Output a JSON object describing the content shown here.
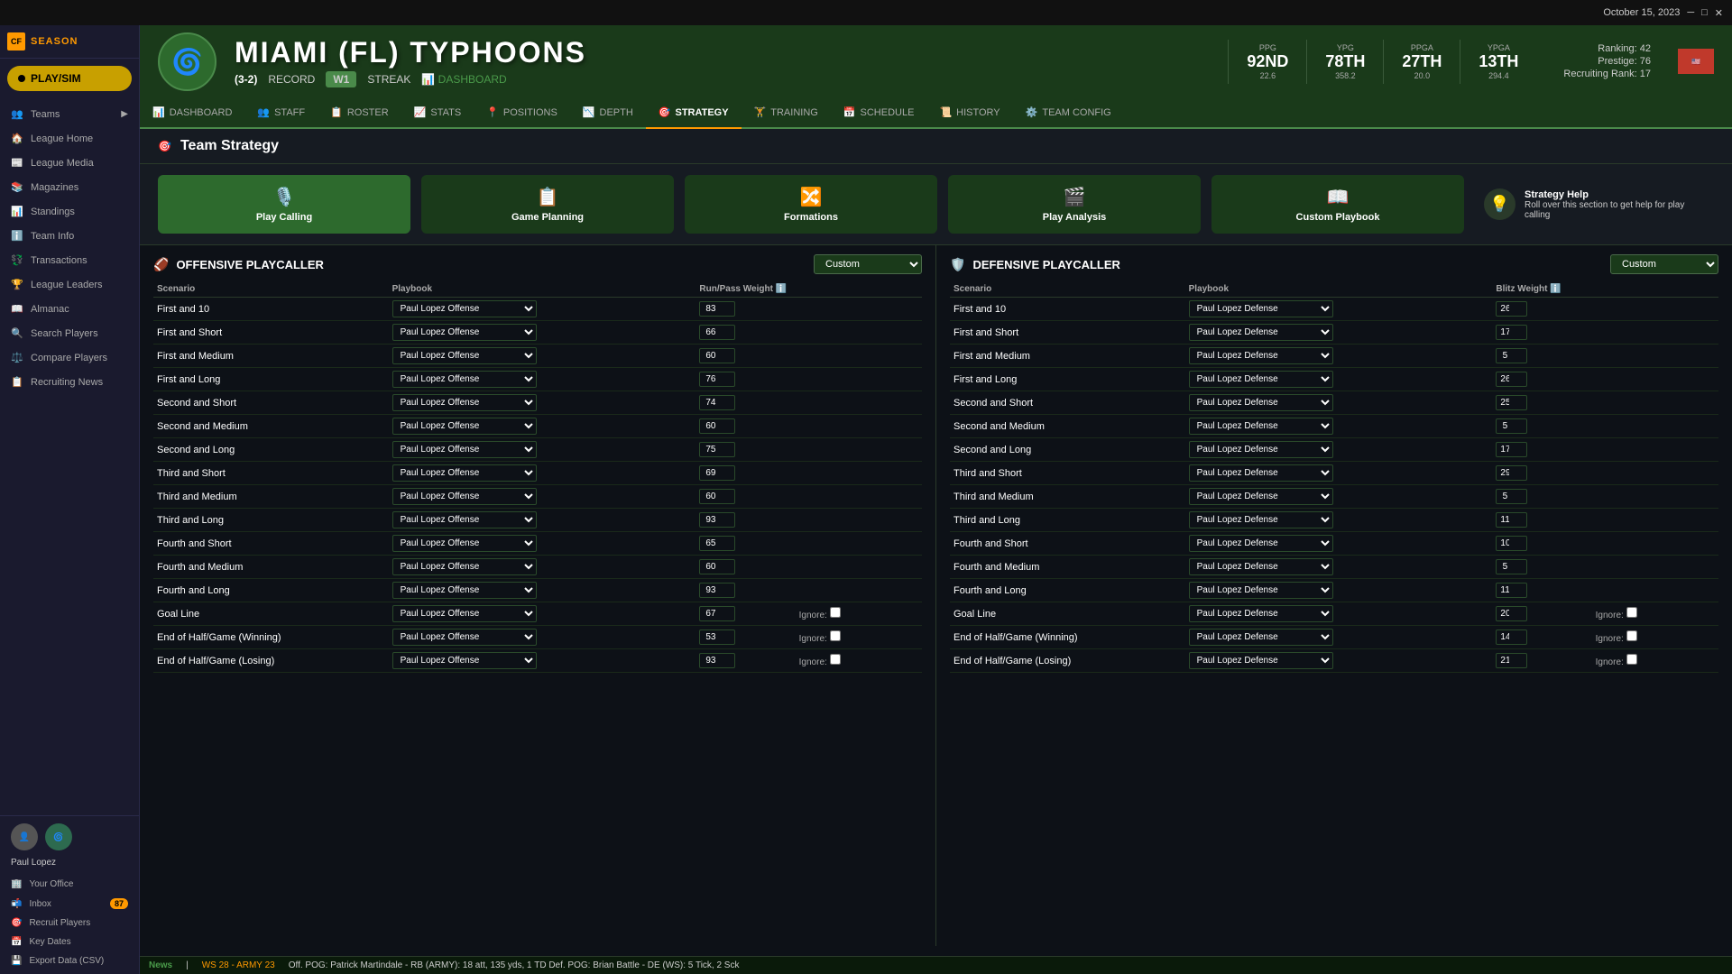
{
  "titlebar": {
    "date": "October 15, 2023"
  },
  "sidebar": {
    "logo_text": "SEASON",
    "play_sim": "PLAY/SIM",
    "items": [
      {
        "label": "Teams",
        "icon": "👥"
      },
      {
        "label": "League Home",
        "icon": "🏠"
      },
      {
        "label": "League Media",
        "icon": "📰"
      },
      {
        "label": "Magazines",
        "icon": "📚"
      },
      {
        "label": "Standings",
        "icon": "📊"
      },
      {
        "label": "Team Info",
        "icon": "ℹ️"
      },
      {
        "label": "Transactions",
        "icon": "💱"
      },
      {
        "label": "League Leaders",
        "icon": "🏆"
      },
      {
        "label": "Almanac",
        "icon": "📖"
      },
      {
        "label": "Search Players",
        "icon": "🔍"
      },
      {
        "label": "Compare Players",
        "icon": "⚖️"
      },
      {
        "label": "Recruiting News",
        "icon": "📋"
      }
    ],
    "user_name": "Paul Lopez",
    "bottom": [
      {
        "label": "Your Office",
        "icon": "🏢"
      },
      {
        "label": "Inbox",
        "icon": "📬",
        "badge": "87"
      },
      {
        "label": "Recruit Players",
        "icon": "🎯"
      },
      {
        "label": "Key Dates",
        "icon": "📅"
      },
      {
        "label": "Export Data (CSV)",
        "icon": "💾"
      }
    ]
  },
  "team": {
    "name": "MIAMI (FL) TYPHOONS",
    "record": "(3-2)",
    "record_label": "RECORD",
    "streak": "W1",
    "streak_label": "STREAK",
    "stats": [
      {
        "label": "PPG",
        "rank": "92ND",
        "value": "22.6"
      },
      {
        "label": "YPG",
        "rank": "78TH",
        "value": "358.2"
      },
      {
        "label": "PPGA",
        "rank": "27TH",
        "value": "20.0"
      },
      {
        "label": "YPGA",
        "rank": "13TH",
        "value": "294.4"
      }
    ],
    "ranking": "Ranking: 42",
    "prestige": "Prestige: 76",
    "recruiting_rank": "Recruiting Rank: 17"
  },
  "nav_tabs": [
    {
      "label": "DASHBOARD",
      "icon": "📊",
      "active": false
    },
    {
      "label": "STAFF",
      "icon": "👥",
      "active": false
    },
    {
      "label": "ROSTER",
      "icon": "📋",
      "active": false
    },
    {
      "label": "STATS",
      "icon": "📈",
      "active": false
    },
    {
      "label": "POSITIONS",
      "icon": "📍",
      "active": false
    },
    {
      "label": "DEPTH",
      "icon": "📉",
      "active": false
    },
    {
      "label": "STRATEGY",
      "icon": "🎯",
      "active": true
    },
    {
      "label": "TRAINING",
      "icon": "🏋️",
      "active": false
    },
    {
      "label": "SCHEDULE",
      "icon": "📅",
      "active": false
    },
    {
      "label": "HISTORY",
      "icon": "📜",
      "active": false
    },
    {
      "label": "TEAM CONFIG",
      "icon": "⚙️",
      "active": false
    }
  ],
  "strategy": {
    "title": "Team Strategy",
    "cards": [
      {
        "label": "Play Calling",
        "icon": "🎙️",
        "active": true
      },
      {
        "label": "Game Planning",
        "icon": "📋",
        "active": false
      },
      {
        "label": "Formations",
        "icon": "🔀",
        "active": false
      },
      {
        "label": "Play Analysis",
        "icon": "🎬",
        "active": false
      },
      {
        "label": "Custom Playbook",
        "icon": "📖",
        "active": false
      }
    ],
    "help_title": "Strategy Help",
    "help_text": "Roll over this section to get help for play calling",
    "offensive": {
      "title": "OFFENSIVE PLAYCALLER",
      "playbook_default": "Custom",
      "col_scenario": "Scenario",
      "col_playbook": "Playbook",
      "col_weight": "Run/Pass Weight",
      "scenarios": [
        {
          "name": "First and 10",
          "playbook": "Paul Lopez Offense",
          "weight": "83",
          "show_ignore": false
        },
        {
          "name": "First and Short",
          "playbook": "Paul Lopez Offense",
          "weight": "66",
          "show_ignore": false
        },
        {
          "name": "First and Medium",
          "playbook": "Paul Lopez Offense",
          "weight": "60",
          "show_ignore": false
        },
        {
          "name": "First and Long",
          "playbook": "Paul Lopez Offense",
          "weight": "76",
          "show_ignore": false
        },
        {
          "name": "Second and Short",
          "playbook": "Paul Lopez Offense",
          "weight": "74",
          "show_ignore": false
        },
        {
          "name": "Second and Medium",
          "playbook": "Paul Lopez Offense",
          "weight": "60",
          "show_ignore": false
        },
        {
          "name": "Second and Long",
          "playbook": "Paul Lopez Offense",
          "weight": "75",
          "show_ignore": false
        },
        {
          "name": "Third and Short",
          "playbook": "Paul Lopez Offense",
          "weight": "69",
          "show_ignore": false
        },
        {
          "name": "Third and Medium",
          "playbook": "Paul Lopez Offense",
          "weight": "60",
          "show_ignore": false
        },
        {
          "name": "Third and Long",
          "playbook": "Paul Lopez Offense",
          "weight": "93",
          "show_ignore": false
        },
        {
          "name": "Fourth and Short",
          "playbook": "Paul Lopez Offense",
          "weight": "65",
          "show_ignore": false
        },
        {
          "name": "Fourth and Medium",
          "playbook": "Paul Lopez Offense",
          "weight": "60",
          "show_ignore": false
        },
        {
          "name": "Fourth and Long",
          "playbook": "Paul Lopez Offense",
          "weight": "93",
          "show_ignore": false
        },
        {
          "name": "Goal Line",
          "playbook": "Paul Lopez Offense",
          "weight": "67",
          "show_ignore": true
        },
        {
          "name": "End of Half/Game (Winning)",
          "playbook": "Paul Lopez Offense",
          "weight": "53",
          "show_ignore": true
        },
        {
          "name": "End of Half/Game (Losing)",
          "playbook": "Paul Lopez Offense",
          "weight": "93",
          "show_ignore": true
        }
      ]
    },
    "defensive": {
      "title": "DEFENSIVE PLAYCALLER",
      "playbook_default": "Custom",
      "col_scenario": "Scenario",
      "col_playbook": "Playbook",
      "col_weight": "Blitz Weight",
      "scenarios": [
        {
          "name": "First and 10",
          "playbook": "Paul Lopez Defense",
          "weight": "26",
          "show_ignore": false
        },
        {
          "name": "First and Short",
          "playbook": "Paul Lopez Defense",
          "weight": "17",
          "show_ignore": false
        },
        {
          "name": "First and Medium",
          "playbook": "Paul Lopez Defense",
          "weight": "5",
          "show_ignore": false
        },
        {
          "name": "First and Long",
          "playbook": "Paul Lopez Defense",
          "weight": "26",
          "show_ignore": false
        },
        {
          "name": "Second and Short",
          "playbook": "Paul Lopez Defense",
          "weight": "25",
          "show_ignore": false
        },
        {
          "name": "Second and Medium",
          "playbook": "Paul Lopez Defense",
          "weight": "5",
          "show_ignore": false
        },
        {
          "name": "Second and Long",
          "playbook": "Paul Lopez Defense",
          "weight": "17",
          "show_ignore": false
        },
        {
          "name": "Third and Short",
          "playbook": "Paul Lopez Defense",
          "weight": "29",
          "show_ignore": false
        },
        {
          "name": "Third and Medium",
          "playbook": "Paul Lopez Defense",
          "weight": "5",
          "show_ignore": false
        },
        {
          "name": "Third and Long",
          "playbook": "Paul Lopez Defense",
          "weight": "11",
          "show_ignore": false
        },
        {
          "name": "Fourth and Short",
          "playbook": "Paul Lopez Defense",
          "weight": "10",
          "show_ignore": false
        },
        {
          "name": "Fourth and Medium",
          "playbook": "Paul Lopez Defense",
          "weight": "5",
          "show_ignore": false
        },
        {
          "name": "Fourth and Long",
          "playbook": "Paul Lopez Defense",
          "weight": "11",
          "show_ignore": false
        },
        {
          "name": "Goal Line",
          "playbook": "Paul Lopez Defense",
          "weight": "20",
          "show_ignore": true
        },
        {
          "name": "End of Half/Game (Winning)",
          "playbook": "Paul Lopez Defense",
          "weight": "14",
          "show_ignore": true
        },
        {
          "name": "End of Half/Game (Losing)",
          "playbook": "Paul Lopez Defense",
          "weight": "21",
          "show_ignore": true
        }
      ]
    }
  },
  "ticker": {
    "news_label": "News",
    "score": "WS 28 - ARMY 23",
    "detail": "Off. POG: Patrick Martindale - RB (ARMY): 18 att, 135 yds, 1 TD   Def. POG: Brian Battle - DE (WS): 5 Tick, 2 Sck"
  }
}
